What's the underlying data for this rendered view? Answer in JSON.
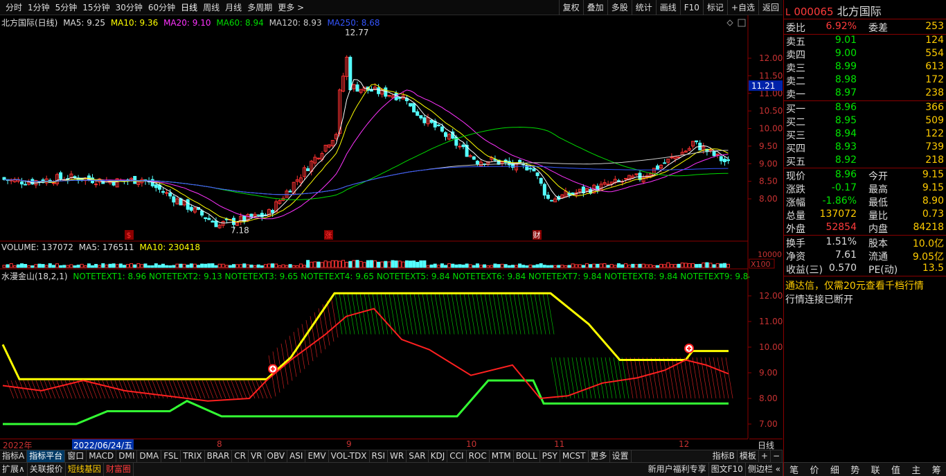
{
  "toolbar": {
    "periods": [
      "分时",
      "1分钟",
      "5分钟",
      "15分钟",
      "30分钟",
      "60分钟",
      "日线",
      "周线",
      "月线",
      "多周期",
      "更多 >"
    ],
    "actions": [
      "复权",
      "叠加",
      "多股",
      "统计",
      "画线",
      "F10",
      "标记",
      "+自选",
      "返回"
    ]
  },
  "main_legend": {
    "title": "北方国际(日线)",
    "ma5": "MA5: 9.25",
    "ma10": "MA10: 9.36",
    "ma20": "MA20: 9.10",
    "ma60": "MA60: 8.94",
    "ma120": "MA120: 8.93",
    "ma250": "MA250: 8.68",
    "high_label": "12.77",
    "low_label": "7.18",
    "price_tag": "11.21",
    "axis": [
      "12.00",
      "11.50",
      "11.00",
      "10.50",
      "10.00",
      "9.50",
      "9.00",
      "8.50",
      "8.00"
    ],
    "markers": [
      "$",
      "涨",
      "财"
    ]
  },
  "volume_legend": {
    "volume": "VOLUME: 137072",
    "ma5": "MA5: 176511",
    "ma10": "MA10: 230418",
    "axis_top": "10000",
    "unit": "X100"
  },
  "indicator_legend": {
    "title": "水漫金山(18,2,1)",
    "notes": "NOTETEXT1: 8.96  NOTETEXT2: 9.13  NOTETEXT3: 9.65  NOTETEXT4: 9.65  NOTETEXT5: 9.84  NOTETEXT6: 9.84  NOTETEXT7: 9.84  NOTETEXT8: 9.84  NOTETEXT9: 9.84  NOTETE",
    "axis": [
      "12.00",
      "11.00",
      "10.00",
      "9.00",
      "8.00",
      "7.00"
    ]
  },
  "x_axis": {
    "year": "2022年",
    "cursor_date": "2022/06/24/五",
    "months": [
      "8",
      "9",
      "10",
      "11",
      "12"
    ],
    "period": "日线"
  },
  "indicator_tabs": [
    "指标A",
    "指标平台",
    "窗口",
    "MACD",
    "DMI",
    "DMA",
    "FSL",
    "TRIX",
    "BRAR",
    "CR",
    "VR",
    "OBV",
    "ASI",
    "EMV",
    "VOL-TDX",
    "RSI",
    "WR",
    "SAR",
    "KDJ",
    "CCI",
    "ROC",
    "MTM",
    "BOLL",
    "PSY",
    "MCST",
    "更多",
    "设置"
  ],
  "indicator_tabs_right": [
    "指标B",
    "模板",
    "+",
    "−"
  ],
  "bottom_tabs": [
    "扩展∧",
    "关联报价",
    "短线基因",
    "财富圈"
  ],
  "bottom_right": [
    "新用户福利专享",
    "图文F10",
    "侧边栏 «"
  ],
  "quote": {
    "code": "000065",
    "name": "北方国际",
    "weibi_label": "委比",
    "weibi": "6.92%",
    "weicha_label": "委差",
    "weicha": "253",
    "asks": [
      {
        "label": "卖五",
        "price": "9.01",
        "vol": "124"
      },
      {
        "label": "卖四",
        "price": "9.00",
        "vol": "554"
      },
      {
        "label": "卖三",
        "price": "8.99",
        "vol": "613"
      },
      {
        "label": "卖二",
        "price": "8.98",
        "vol": "172"
      },
      {
        "label": "卖一",
        "price": "8.97",
        "vol": "238"
      }
    ],
    "bids": [
      {
        "label": "买一",
        "price": "8.96",
        "vol": "366"
      },
      {
        "label": "买二",
        "price": "8.95",
        "vol": "509"
      },
      {
        "label": "买三",
        "price": "8.94",
        "vol": "122"
      },
      {
        "label": "买四",
        "price": "8.93",
        "vol": "739"
      },
      {
        "label": "买五",
        "price": "8.92",
        "vol": "218"
      }
    ],
    "stats": [
      {
        "l1": "现价",
        "v1": "8.96",
        "l2": "今开",
        "v2": "9.15"
      },
      {
        "l1": "涨跌",
        "v1": "-0.17",
        "l2": "最高",
        "v2": "9.15"
      },
      {
        "l1": "涨幅",
        "v1": "-1.86%",
        "l2": "最低",
        "v2": "8.90"
      },
      {
        "l1": "总量",
        "v1": "137072",
        "l2": "量比",
        "v2": "0.73"
      },
      {
        "l1": "外盘",
        "v1": "52854",
        "l2": "内盘",
        "v2": "84218"
      }
    ],
    "stats2": [
      {
        "l1": "换手",
        "v1": "1.51%",
        "l2": "股本",
        "v2": "10.0亿"
      },
      {
        "l1": "净资",
        "v1": "7.61",
        "l2": "流通",
        "v2": "9.05亿"
      },
      {
        "l1": "收益(三)",
        "v1": "0.570",
        "l2": "PE(动)",
        "v2": "13.5"
      }
    ],
    "notice": "通达信，仅需20元查看千档行情",
    "notice2": "行情连接已断开",
    "side_tabs": [
      "笔",
      "价",
      "细",
      "势",
      "联",
      "值",
      "主",
      "筹"
    ]
  }
}
